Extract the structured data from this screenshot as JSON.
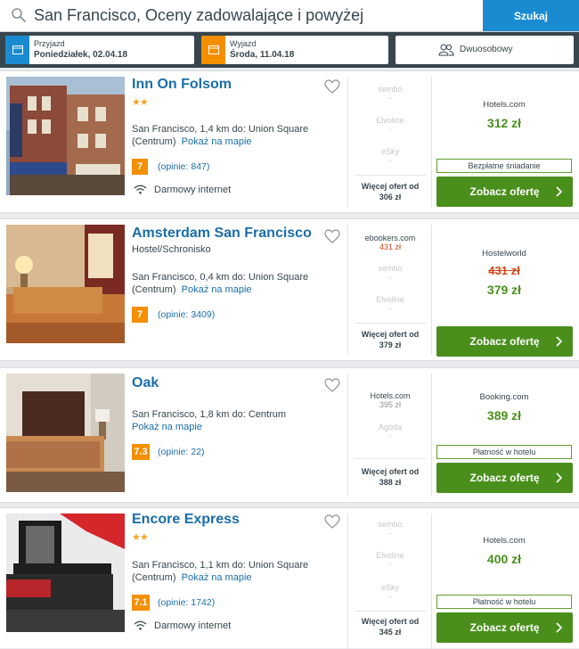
{
  "search": {
    "query": "San Francisco, Oceny zadowalające i powyżej",
    "button": "Szukaj"
  },
  "dates": {
    "checkin_label": "Przyjazd",
    "checkin_value": "Poniedziałek, 02.04.18",
    "checkout_label": "Wyjazd",
    "checkout_value": "Środa, 11.04.18",
    "room": "Dwuosobowy"
  },
  "colors": {
    "link": "#1a6ea8",
    "accent_blue": "#1a8bd1",
    "rating_orange": "#f48f00",
    "deal_green": "#4a8f1c",
    "strike_red": "#d0461b"
  },
  "hotels": [
    {
      "name": "Inn On Folsom",
      "stars": "★★",
      "type": "",
      "location": "San Francisco, 1,4 km do: Union Square (Centrum)",
      "map_link": "Pokaż na mapie",
      "rating": "7",
      "reviews": "(opinie: 847)",
      "amenity": "Darmowy internet",
      "providers": [
        {
          "name": "sembo",
          "price": "-"
        },
        {
          "name": "Elvoline",
          "price": "-"
        },
        {
          "name": "eSky",
          "price": "-"
        }
      ],
      "more_label": "Więcej ofert od",
      "more_price": "306 zł",
      "deal_site": "Hotels.com",
      "deal_old_price": "",
      "deal_price": "312 zł",
      "perk": "Bezpłatne śniadanie",
      "offer_button": "Zobacz ofertę"
    },
    {
      "name": "Amsterdam San Francisco",
      "stars": "",
      "type": "Hostel/Schronisko",
      "location": "San Francisco, 0,4 km do: Union Square (Centrum)",
      "map_link": "Pokaż na mapie",
      "rating": "7",
      "reviews": "(opinie: 3409)",
      "amenity": "",
      "providers": [
        {
          "name": "ebookers.com",
          "price": "431 zł"
        },
        {
          "name": "sembo",
          "price": "-"
        },
        {
          "name": "Elvoline",
          "price": "-"
        }
      ],
      "more_label": "Więcej ofert od",
      "more_price": "379 zł",
      "deal_site": "Hostelworld",
      "deal_old_price": "431 zł",
      "deal_price": "379 zł",
      "perk": "",
      "offer_button": "Zobacz ofertę"
    },
    {
      "name": "Oak",
      "stars": "",
      "type": "",
      "location": "San Francisco, 1,8 km do: Centrum",
      "map_link": "Pokaż na mapie",
      "rating": "7.3",
      "reviews": "(opinie: 22)",
      "amenity": "",
      "providers": [
        {
          "name": "Hotels.com",
          "price": "395 zł"
        },
        {
          "name": "Agoda",
          "price": "-"
        }
      ],
      "more_label": "Więcej ofert od",
      "more_price": "388 zł",
      "deal_site": "Booking.com",
      "deal_old_price": "",
      "deal_price": "389 zł",
      "perk": "Płatność w hotelu",
      "offer_button": "Zobacz ofertę"
    },
    {
      "name": "Encore Express",
      "stars": "★★",
      "type": "",
      "location": "San Francisco, 1,1 km do: Union Square (Centrum)",
      "map_link": "Pokaż na mapie",
      "rating": "7.1",
      "reviews": "(opinie: 1742)",
      "amenity": "Darmowy internet",
      "providers": [
        {
          "name": "sembo",
          "price": "-"
        },
        {
          "name": "Elvoline",
          "price": "-"
        },
        {
          "name": "eSky",
          "price": "-"
        }
      ],
      "more_label": "Więcej ofert od",
      "more_price": "345 zł",
      "deal_site": "Hotels.com",
      "deal_old_price": "",
      "deal_price": "400 zł",
      "perk": "Płatność w hotelu",
      "offer_button": "Zobacz ofertę"
    }
  ]
}
